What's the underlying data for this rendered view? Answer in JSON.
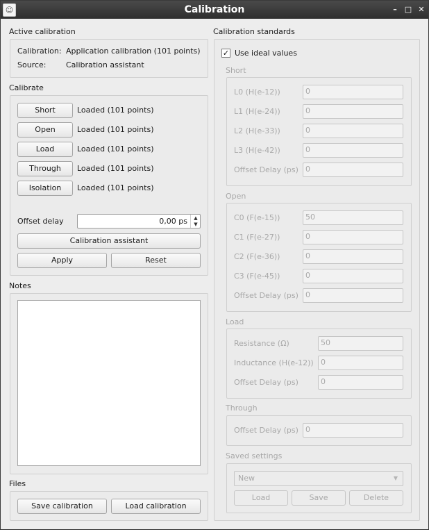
{
  "window": {
    "title": "Calibration",
    "minimize": "–",
    "maximize": "□",
    "close": "✕"
  },
  "active": {
    "title": "Active calibration",
    "calibration_label": "Calibration:",
    "calibration_value": "Application calibration (101 points)",
    "source_label": "Source:",
    "source_value": "Calibration assistant"
  },
  "calibrate": {
    "title": "Calibrate",
    "rows": [
      {
        "button": "Short",
        "status": "Loaded (101 points)"
      },
      {
        "button": "Open",
        "status": "Loaded (101 points)"
      },
      {
        "button": "Load",
        "status": "Loaded (101 points)"
      },
      {
        "button": "Through",
        "status": "Loaded (101 points)"
      },
      {
        "button": "Isolation",
        "status": "Loaded (101 points)"
      }
    ],
    "offset_label": "Offset delay",
    "offset_value": "0,00 ps",
    "assistant_button": "Calibration assistant",
    "apply_button": "Apply",
    "reset_button": "Reset"
  },
  "notes": {
    "title": "Notes",
    "text": ""
  },
  "files": {
    "title": "Files",
    "save_button": "Save calibration",
    "load_button": "Load calibration"
  },
  "standards": {
    "title": "Calibration standards",
    "use_ideal_label": "Use ideal values",
    "use_ideal_checked": true,
    "short": {
      "title": "Short",
      "fields": [
        {
          "label": "L0 (H(e-12))",
          "value": "0"
        },
        {
          "label": "L1 (H(e-24))",
          "value": "0"
        },
        {
          "label": "L2 (H(e-33))",
          "value": "0"
        },
        {
          "label": "L3 (H(e-42))",
          "value": "0"
        },
        {
          "label": "Offset Delay (ps)",
          "value": "0"
        }
      ]
    },
    "open": {
      "title": "Open",
      "fields": [
        {
          "label": "C0 (F(e-15))",
          "value": "50"
        },
        {
          "label": "C1 (F(e-27))",
          "value": "0"
        },
        {
          "label": "C2 (F(e-36))",
          "value": "0"
        },
        {
          "label": "C3 (F(e-45))",
          "value": "0"
        },
        {
          "label": "Offset Delay (ps)",
          "value": "0"
        }
      ]
    },
    "load": {
      "title": "Load",
      "fields": [
        {
          "label": "Resistance (Ω)",
          "value": "50"
        },
        {
          "label": "Inductance (H(e-12))",
          "value": "0"
        },
        {
          "label": "Offset Delay (ps)",
          "value": "0"
        }
      ]
    },
    "through": {
      "title": "Through",
      "fields": [
        {
          "label": "Offset Delay (ps)",
          "value": "0"
        }
      ]
    },
    "saved": {
      "title": "Saved settings",
      "combo_value": "New",
      "load_button": "Load",
      "save_button": "Save",
      "delete_button": "Delete"
    }
  }
}
